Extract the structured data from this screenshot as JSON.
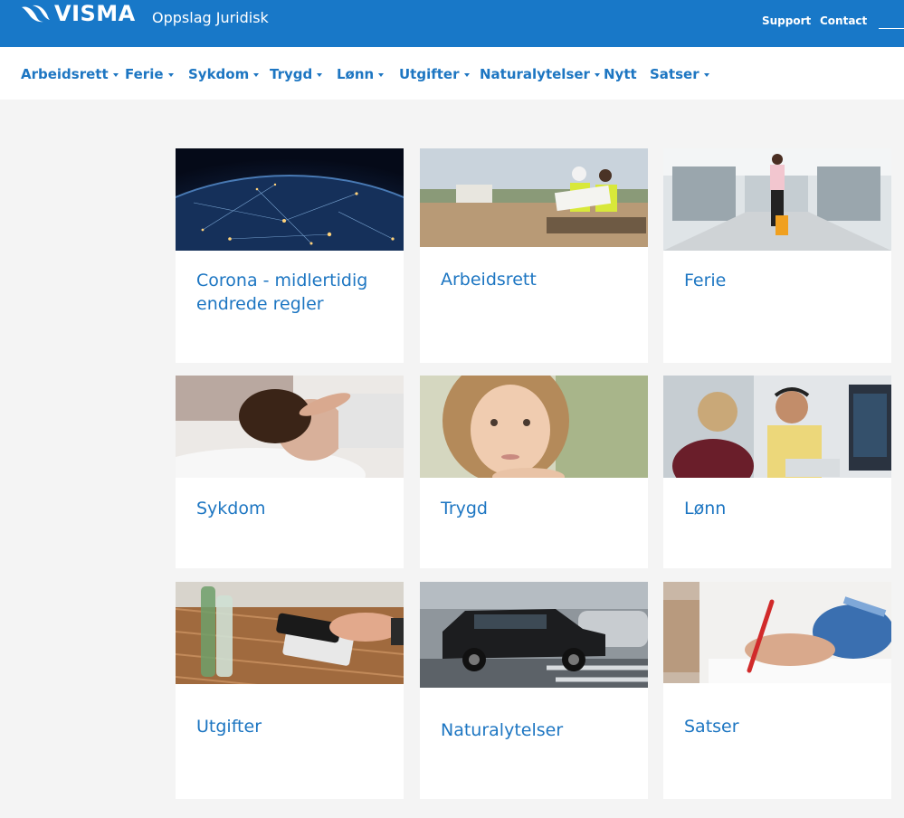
{
  "header": {
    "brand": "VISMA",
    "app_title": "Oppslag Juridisk",
    "links": [
      "Support",
      "Contact"
    ]
  },
  "nav": {
    "items": [
      {
        "label": "Arbeidsrett",
        "dropdown": true
      },
      {
        "label": "Ferie",
        "dropdown": true
      },
      {
        "label": "Sykdom",
        "dropdown": true
      },
      {
        "label": "Trygd",
        "dropdown": true
      },
      {
        "label": "Lønn",
        "dropdown": true
      },
      {
        "label": "Utgifter",
        "dropdown": true
      },
      {
        "label": "Naturalytelser",
        "dropdown": true
      },
      {
        "label": "Nytt",
        "dropdown": false
      },
      {
        "label": "Satser",
        "dropdown": true
      }
    ]
  },
  "cards": [
    {
      "title": "Corona - midlertidig endrede regler",
      "image": "earth-network-image"
    },
    {
      "title": "Arbeidsrett",
      "image": "construction-workers-image"
    },
    {
      "title": "Ferie",
      "image": "airport-traveler-image"
    },
    {
      "title": "Sykdom",
      "image": "sick-woman-image"
    },
    {
      "title": "Trygd",
      "image": "child-portrait-image"
    },
    {
      "title": "Lønn",
      "image": "office-workers-image"
    },
    {
      "title": "Utgifter",
      "image": "card-payment-image"
    },
    {
      "title": "Naturalytelser",
      "image": "car-traffic-image"
    },
    {
      "title": "Satser",
      "image": "writing-hand-image"
    }
  ],
  "colors": {
    "brand_blue": "#1878c8",
    "link_blue": "#1d76c2",
    "background": "#f4f4f4"
  }
}
